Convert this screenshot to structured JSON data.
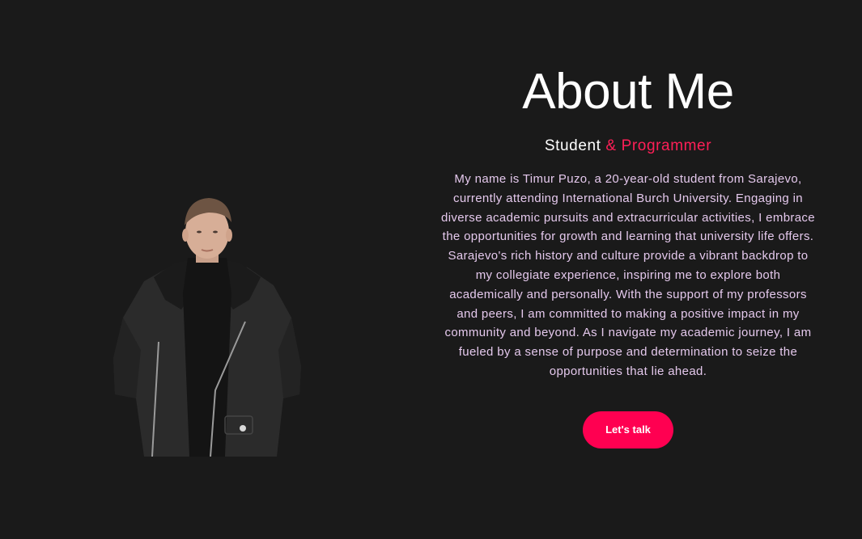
{
  "about": {
    "title": "About Me",
    "subtitle_part1": "Student",
    "subtitle_part2": " & Programmer",
    "bio": "My name is Timur Puzo, a 20-year-old student from Sarajevo, currently attending International Burch University. Engaging in diverse academic pursuits and extracurricular activities, I embrace the opportunities for growth and learning that university life offers. Sarajevo's rich history and culture provide a vibrant backdrop to my collegiate experience, inspiring me to explore both academically and personally. With the support of my professors and peers, I am committed to making a positive impact in my community and beyond. As I navigate my academic journey, I am fueled by a sense of purpose and determination to seize the opportunities that lie ahead.",
    "cta_label": "Let's talk"
  },
  "colors": {
    "background": "#1a1a1a",
    "accent": "#ff0051",
    "bio_text": "#e4c8ec"
  }
}
